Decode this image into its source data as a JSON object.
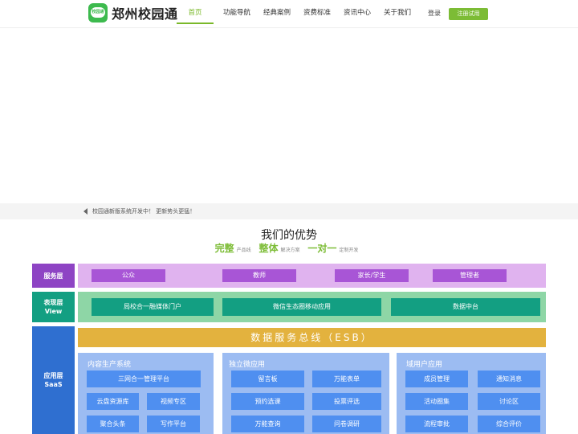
{
  "header": {
    "logo_badge_text": "校园通",
    "logo_text": "郑州校园通",
    "nav": [
      {
        "label": "首页",
        "active": true
      },
      {
        "label": "功能导航"
      },
      {
        "label": "经典案例"
      },
      {
        "label": "资费标准"
      },
      {
        "label": "资讯中心"
      },
      {
        "label": "关于我们"
      }
    ],
    "login_label": "登录",
    "register_label": "注册试用"
  },
  "notice": {
    "text": "校园通新版系统开发中！ 更新势头更猛！"
  },
  "advantages": {
    "title": "我们的优势",
    "slogan": [
      {
        "big": "完整",
        "small": "产品线"
      },
      {
        "big": "整体",
        "small": "解决方案"
      },
      {
        "big": "一对一",
        "small": "定制开发"
      }
    ]
  },
  "architecture": {
    "service_layer": {
      "label": "服务层",
      "items": [
        "公众",
        "教师",
        "家长/学生",
        "管理者"
      ]
    },
    "view_layer": {
      "label_cn": "表现层",
      "label_en": "View",
      "items": [
        "局校合一融媒体门户",
        "微信生态圈移动应用",
        "数据中台"
      ]
    },
    "app_layer": {
      "label_cn": "应用层",
      "label_en": "SaaS",
      "esb": "数据服务总线（ESB）",
      "panels": [
        {
          "title": "内容生产系统",
          "items": [
            "三网合一管理平台",
            "云盘资源库",
            "视频专区",
            "聚合头条",
            "写作平台"
          ]
        },
        {
          "title": "独立微应用",
          "items": [
            "留言板",
            "万能表单",
            "预约选课",
            "投票评选",
            "万能查询",
            "问卷调研"
          ]
        },
        {
          "title": "域用户应用",
          "items": [
            "成员管理",
            "通知消息",
            "活动圈集",
            "讨论区",
            "流程审批",
            "综合评价"
          ]
        }
      ]
    }
  },
  "colors": {
    "accent_green": "#7cbc35",
    "service_purple": "#a855d6",
    "view_teal": "#139f82",
    "esb_gold": "#e3b23e",
    "app_blue": "#4f8ff0"
  }
}
